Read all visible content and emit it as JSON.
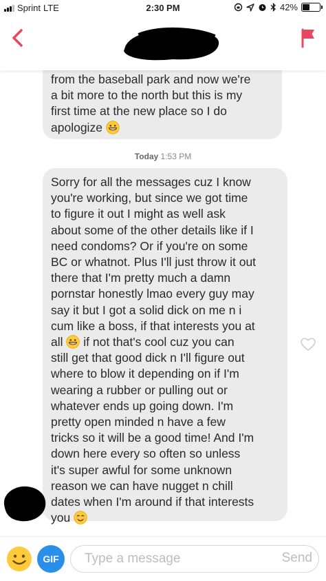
{
  "status_bar": {
    "carrier": "Sprint",
    "network": "LTE",
    "time": "2:30 PM",
    "battery_percent": "42%",
    "battery_level": 0.42
  },
  "header": {
    "back_icon": "chevron-left-icon",
    "report_icon": "flag-icon",
    "accent_color": "#e8475f"
  },
  "messages": [
    {
      "text": "from the baseball park and now we're\na bit more to the north but this is my\nfirst time at the new place so I do\napologize",
      "emoji": "grinning-face"
    },
    {
      "text": "Sorry for all the messages cuz I know\nyou're working, but since we got time\nto figure it out I might as well ask\nabout some of the other details like if I\nneed condoms? Or if you're on some\nBC or whatnot. Plus I'll just throw it out\nthere that I'm pretty much a damn\npornstar honestly lmao every guy may\nsay it but I got a solid dick on me n i\ncum like a boss, if that interests you at\nall",
      "emoji_mid": "grinning-face",
      "text_after": " if not that's cool cuz you can\nstill get that good dick n I'll figure out\nwhere to blow it depending on if I'm\nwearing a rubber or pulling out or\nwhatever ends up going down. I'm\npretty open minded n have a few\ntricks so it will be a good time! And I'm\ndown here every so often so unless\nit's super awful for some unknown\nreason we can have nugget n chill\ndates when I'm around if that interests\nyou",
      "emoji_end": "smiling-face"
    }
  ],
  "timestamp": {
    "day": "Today",
    "time": "1:53 PM"
  },
  "composer": {
    "gif_label": "GIF",
    "placeholder": "Type a message",
    "send_label": "Send",
    "gif_color": "#2a8fe8"
  }
}
